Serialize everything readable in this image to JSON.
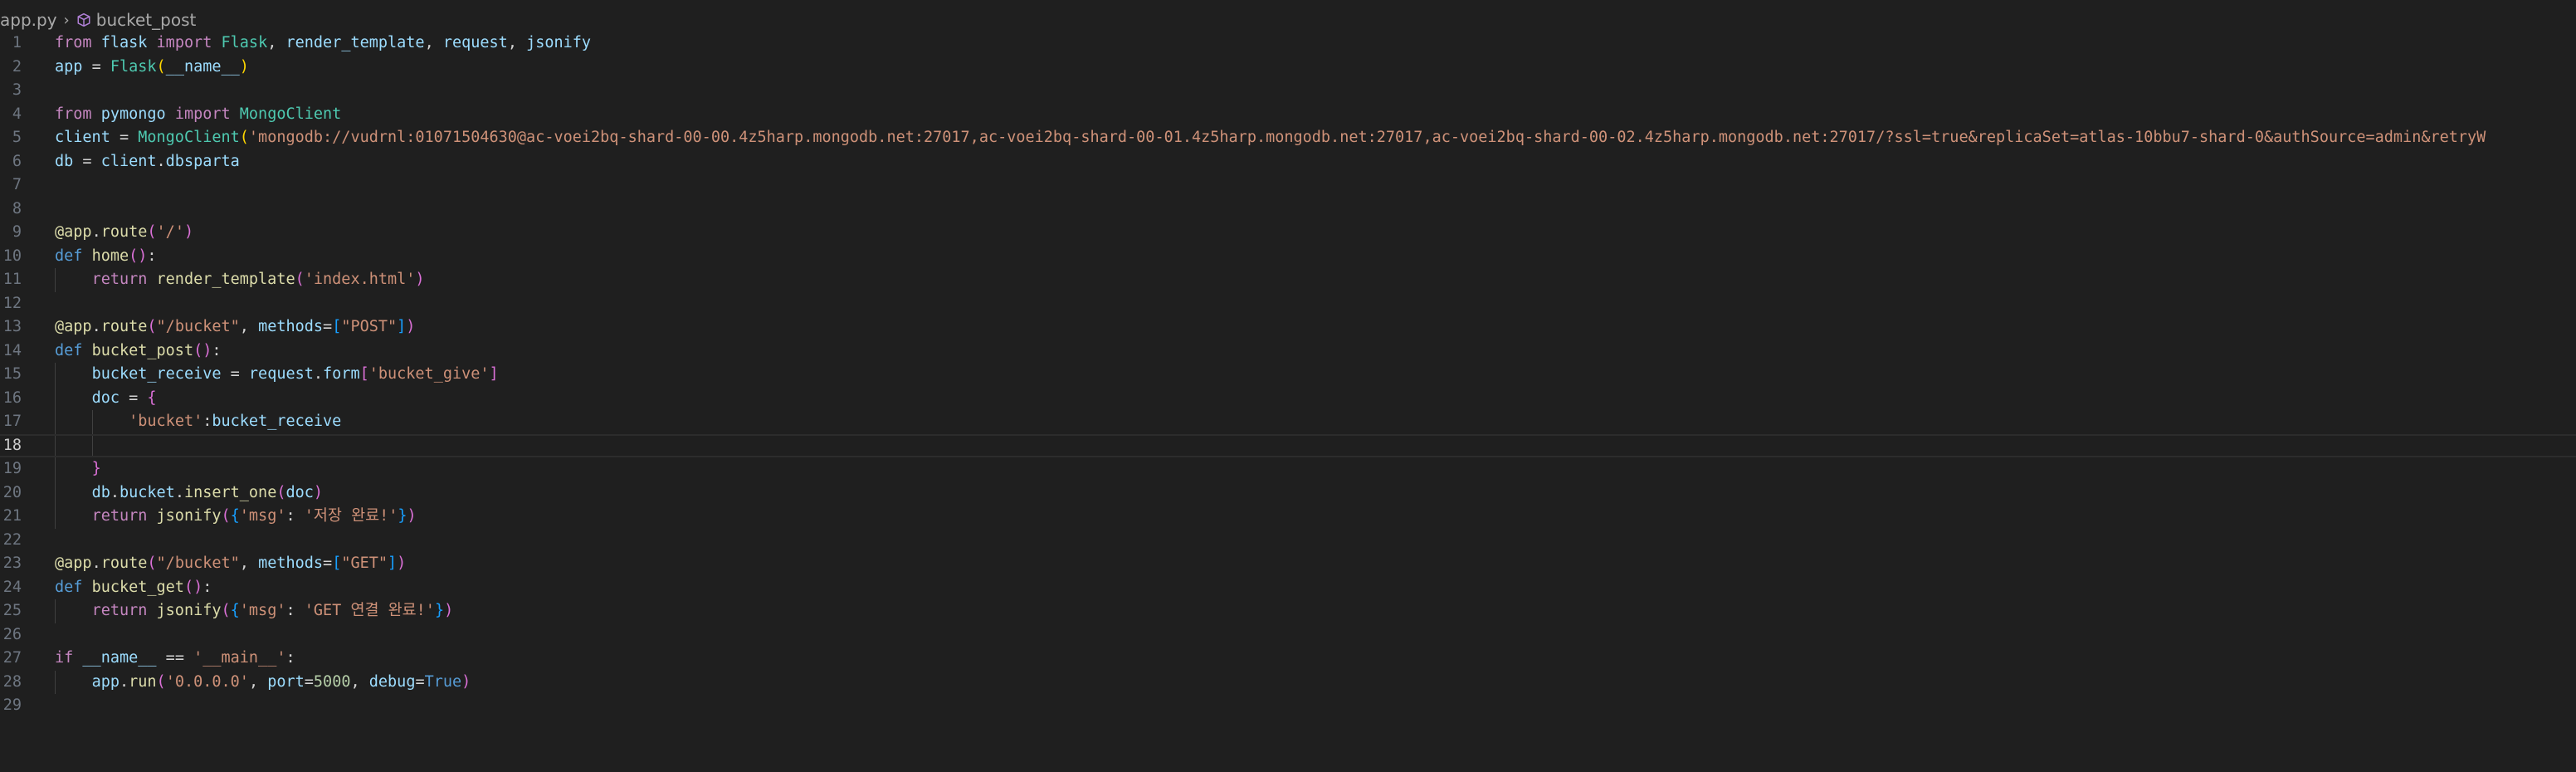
{
  "breadcrumb": {
    "file": "app.py",
    "symbol": "bucket_post"
  },
  "current_line": 18,
  "lines": [
    {
      "n": "1",
      "t": "from flask import Flask, render_template, request, jsonify"
    },
    {
      "n": "2",
      "t": "app = Flask(__name__)"
    },
    {
      "n": "3",
      "t": ""
    },
    {
      "n": "4",
      "t": "from pymongo import MongoClient"
    },
    {
      "n": "5",
      "t": "client = MongoClient('mongodb://vudrnl:01071504630@ac-voei2bq-shard-00-00.4z5harp.mongodb.net:27017,ac-voei2bq-shard-00-01.4z5harp.mongodb.net:27017,ac-voei2bq-shard-00-02.4z5harp.mongodb.net:27017/?ssl=true&replicaSet=atlas-10bbu7-shard-0&authSource=admin&retryW"
    },
    {
      "n": "6",
      "t": "db = client.dbsparta"
    },
    {
      "n": "7",
      "t": ""
    },
    {
      "n": "8",
      "t": ""
    },
    {
      "n": "9",
      "t": "@app.route('/')"
    },
    {
      "n": "10",
      "t": "def home():"
    },
    {
      "n": "11",
      "t": "    return render_template('index.html')"
    },
    {
      "n": "12",
      "t": ""
    },
    {
      "n": "13",
      "t": "@app.route(\"/bucket\", methods=[\"POST\"])"
    },
    {
      "n": "14",
      "t": "def bucket_post():"
    },
    {
      "n": "15",
      "t": "    bucket_receive = request.form['bucket_give']"
    },
    {
      "n": "16",
      "t": "    doc = {"
    },
    {
      "n": "17",
      "t": "        'bucket':bucket_receive"
    },
    {
      "n": "18",
      "t": ""
    },
    {
      "n": "19",
      "t": "    }"
    },
    {
      "n": "20",
      "t": "    db.bucket.insert_one(doc)"
    },
    {
      "n": "21",
      "t": "    return jsonify({'msg': '저장 완료!'})"
    },
    {
      "n": "22",
      "t": ""
    },
    {
      "n": "23",
      "t": "@app.route(\"/bucket\", methods=[\"GET\"])"
    },
    {
      "n": "24",
      "t": "def bucket_get():"
    },
    {
      "n": "25",
      "t": "    return jsonify({'msg': 'GET 연결 완료!'})"
    },
    {
      "n": "26",
      "t": ""
    },
    {
      "n": "27",
      "t": "if __name__ == '__main__':"
    },
    {
      "n": "28",
      "t": "    app.run('0.0.0.0', port=5000, debug=True)"
    },
    {
      "n": "29",
      "t": ""
    }
  ]
}
